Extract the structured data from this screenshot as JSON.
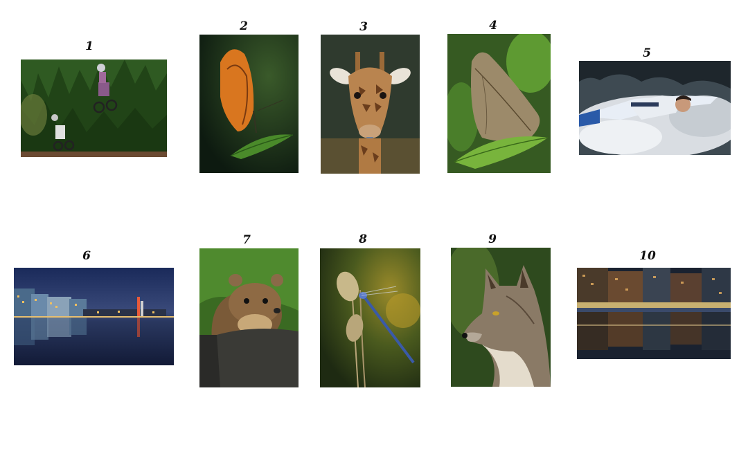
{
  "photos": [
    {
      "number": "1",
      "subject": "motocross riders jumping in front of pine forest"
    },
    {
      "number": "2",
      "subject": "orange butterfly on leaf"
    },
    {
      "number": "3",
      "subject": "giraffe sticking out tongue"
    },
    {
      "number": "4",
      "subject": "brown leaf butterfly on green leaf"
    },
    {
      "number": "5",
      "subject": "kayaker in whitewater"
    },
    {
      "number": "6",
      "subject": "city skyline reflected in water at dusk"
    },
    {
      "number": "7",
      "subject": "pine marten on log"
    },
    {
      "number": "8",
      "subject": "blue damselfly on grass stalk"
    },
    {
      "number": "9",
      "subject": "grey wolf portrait"
    },
    {
      "number": "10",
      "subject": "city buildings reflected in canal at night"
    }
  ]
}
